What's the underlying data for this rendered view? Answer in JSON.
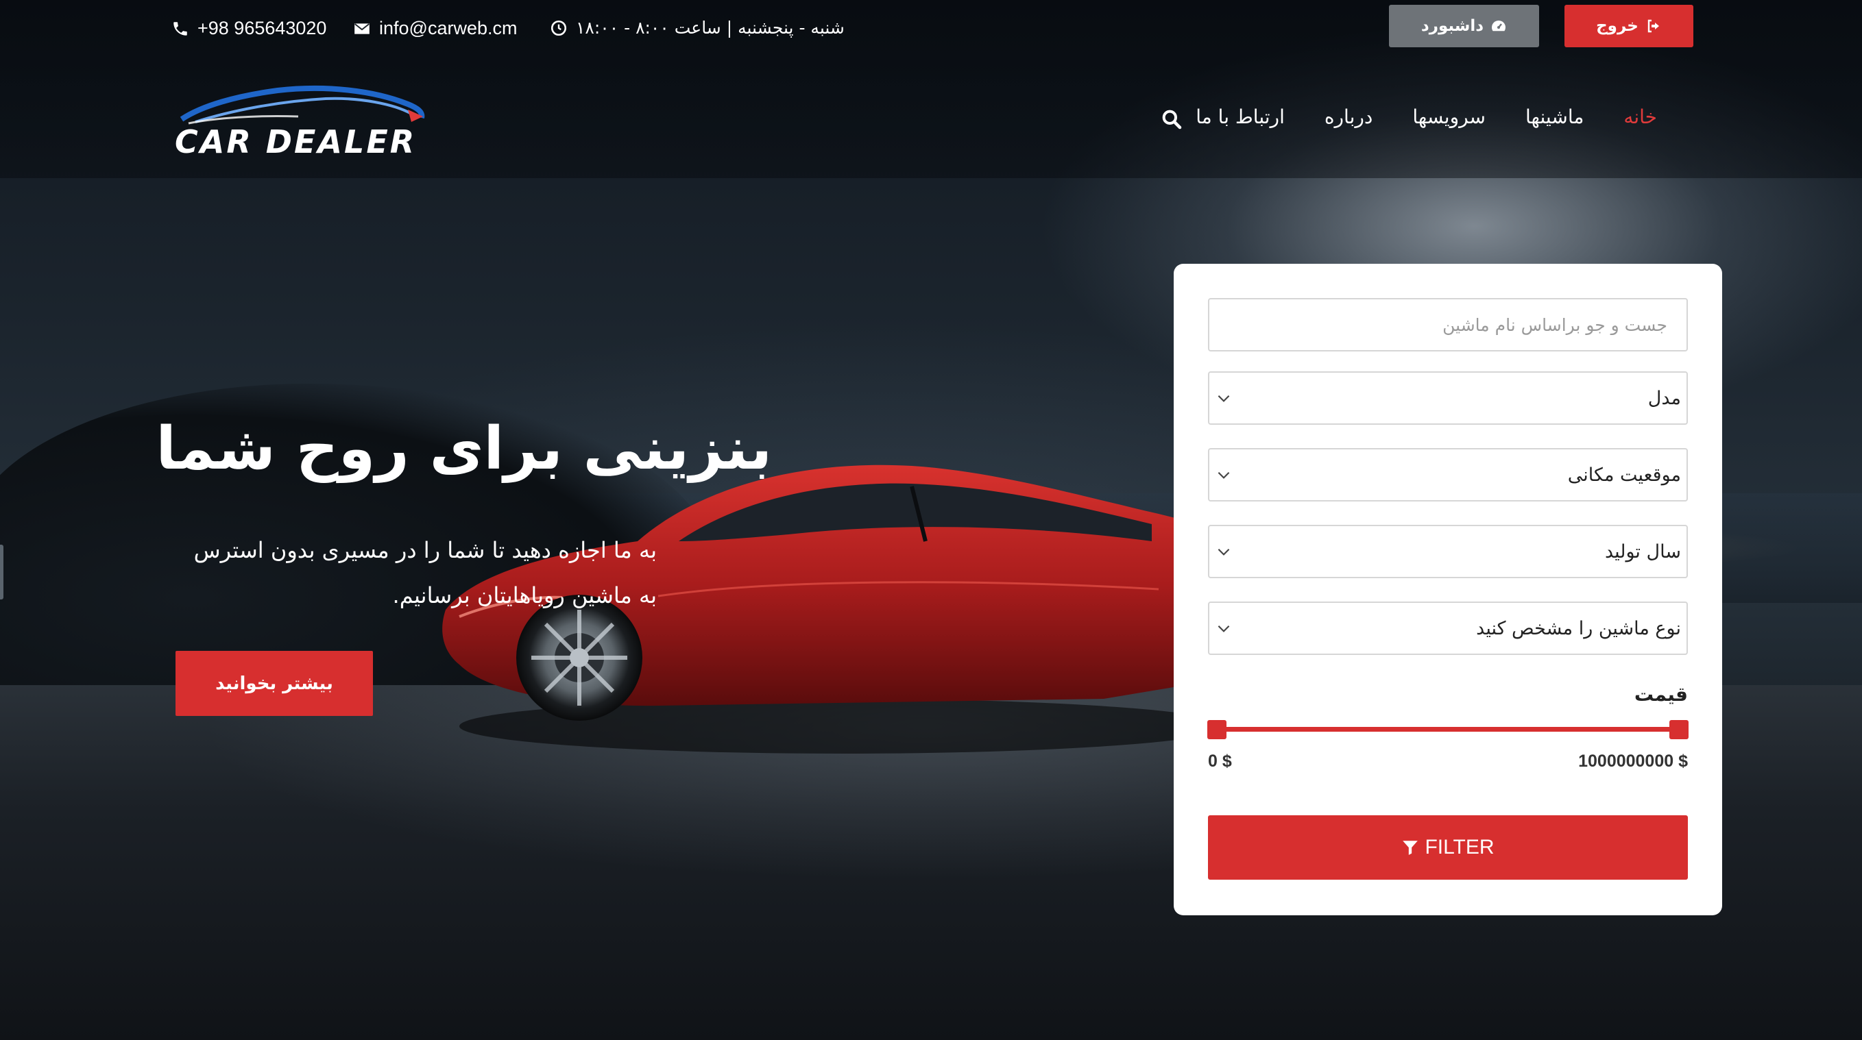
{
  "topbar": {
    "phone": "+98 965643020",
    "email": "info@carweb.cm",
    "hours": "شنبه - پنجشنبه | ساعت ۸:۰۰ - ۱۸:۰۰",
    "dashboard_label": "داشبورد",
    "logout_label": "خروج"
  },
  "brand": {
    "logo_text": "CAR DEALER"
  },
  "nav": {
    "items": [
      {
        "label": "خانه",
        "active": true
      },
      {
        "label": "ماشینها"
      },
      {
        "label": "سرویسها"
      },
      {
        "label": "درباره"
      },
      {
        "label": "ارتباط با ما"
      }
    ]
  },
  "hero": {
    "title": "بنزینی برای روح شما",
    "subtitle": "به ما اجازه دهید تا شما را در مسیری بدون استرس به ماشین رویاهایتان برسانیم.",
    "cta_label": "بیشتر بخوانید"
  },
  "search_card": {
    "search_placeholder": "جست و جو براساس نام ماشین",
    "model": "مدل",
    "location": "موقعیت مکانی",
    "year": "سال تولید",
    "type": "نوع ماشین را مشخص کنید",
    "price_label": "قیمت",
    "price_min": "0 $",
    "price_max": "1000000000 $",
    "price_range": {
      "min": 0,
      "max": 1000000000,
      "selected_min_fraction": 0,
      "selected_max_fraction": 1
    },
    "filter_label": "FILTER"
  },
  "colors": {
    "accent": "#d72f2f",
    "nav_active": "#e03b3b",
    "dashboard_btn": "#6e7378"
  },
  "icons": [
    "phone-icon",
    "envelope-icon",
    "clock-icon",
    "dashboard-icon",
    "sign-out-icon",
    "search-icon",
    "chevron-down-icon",
    "filter-icon"
  ]
}
